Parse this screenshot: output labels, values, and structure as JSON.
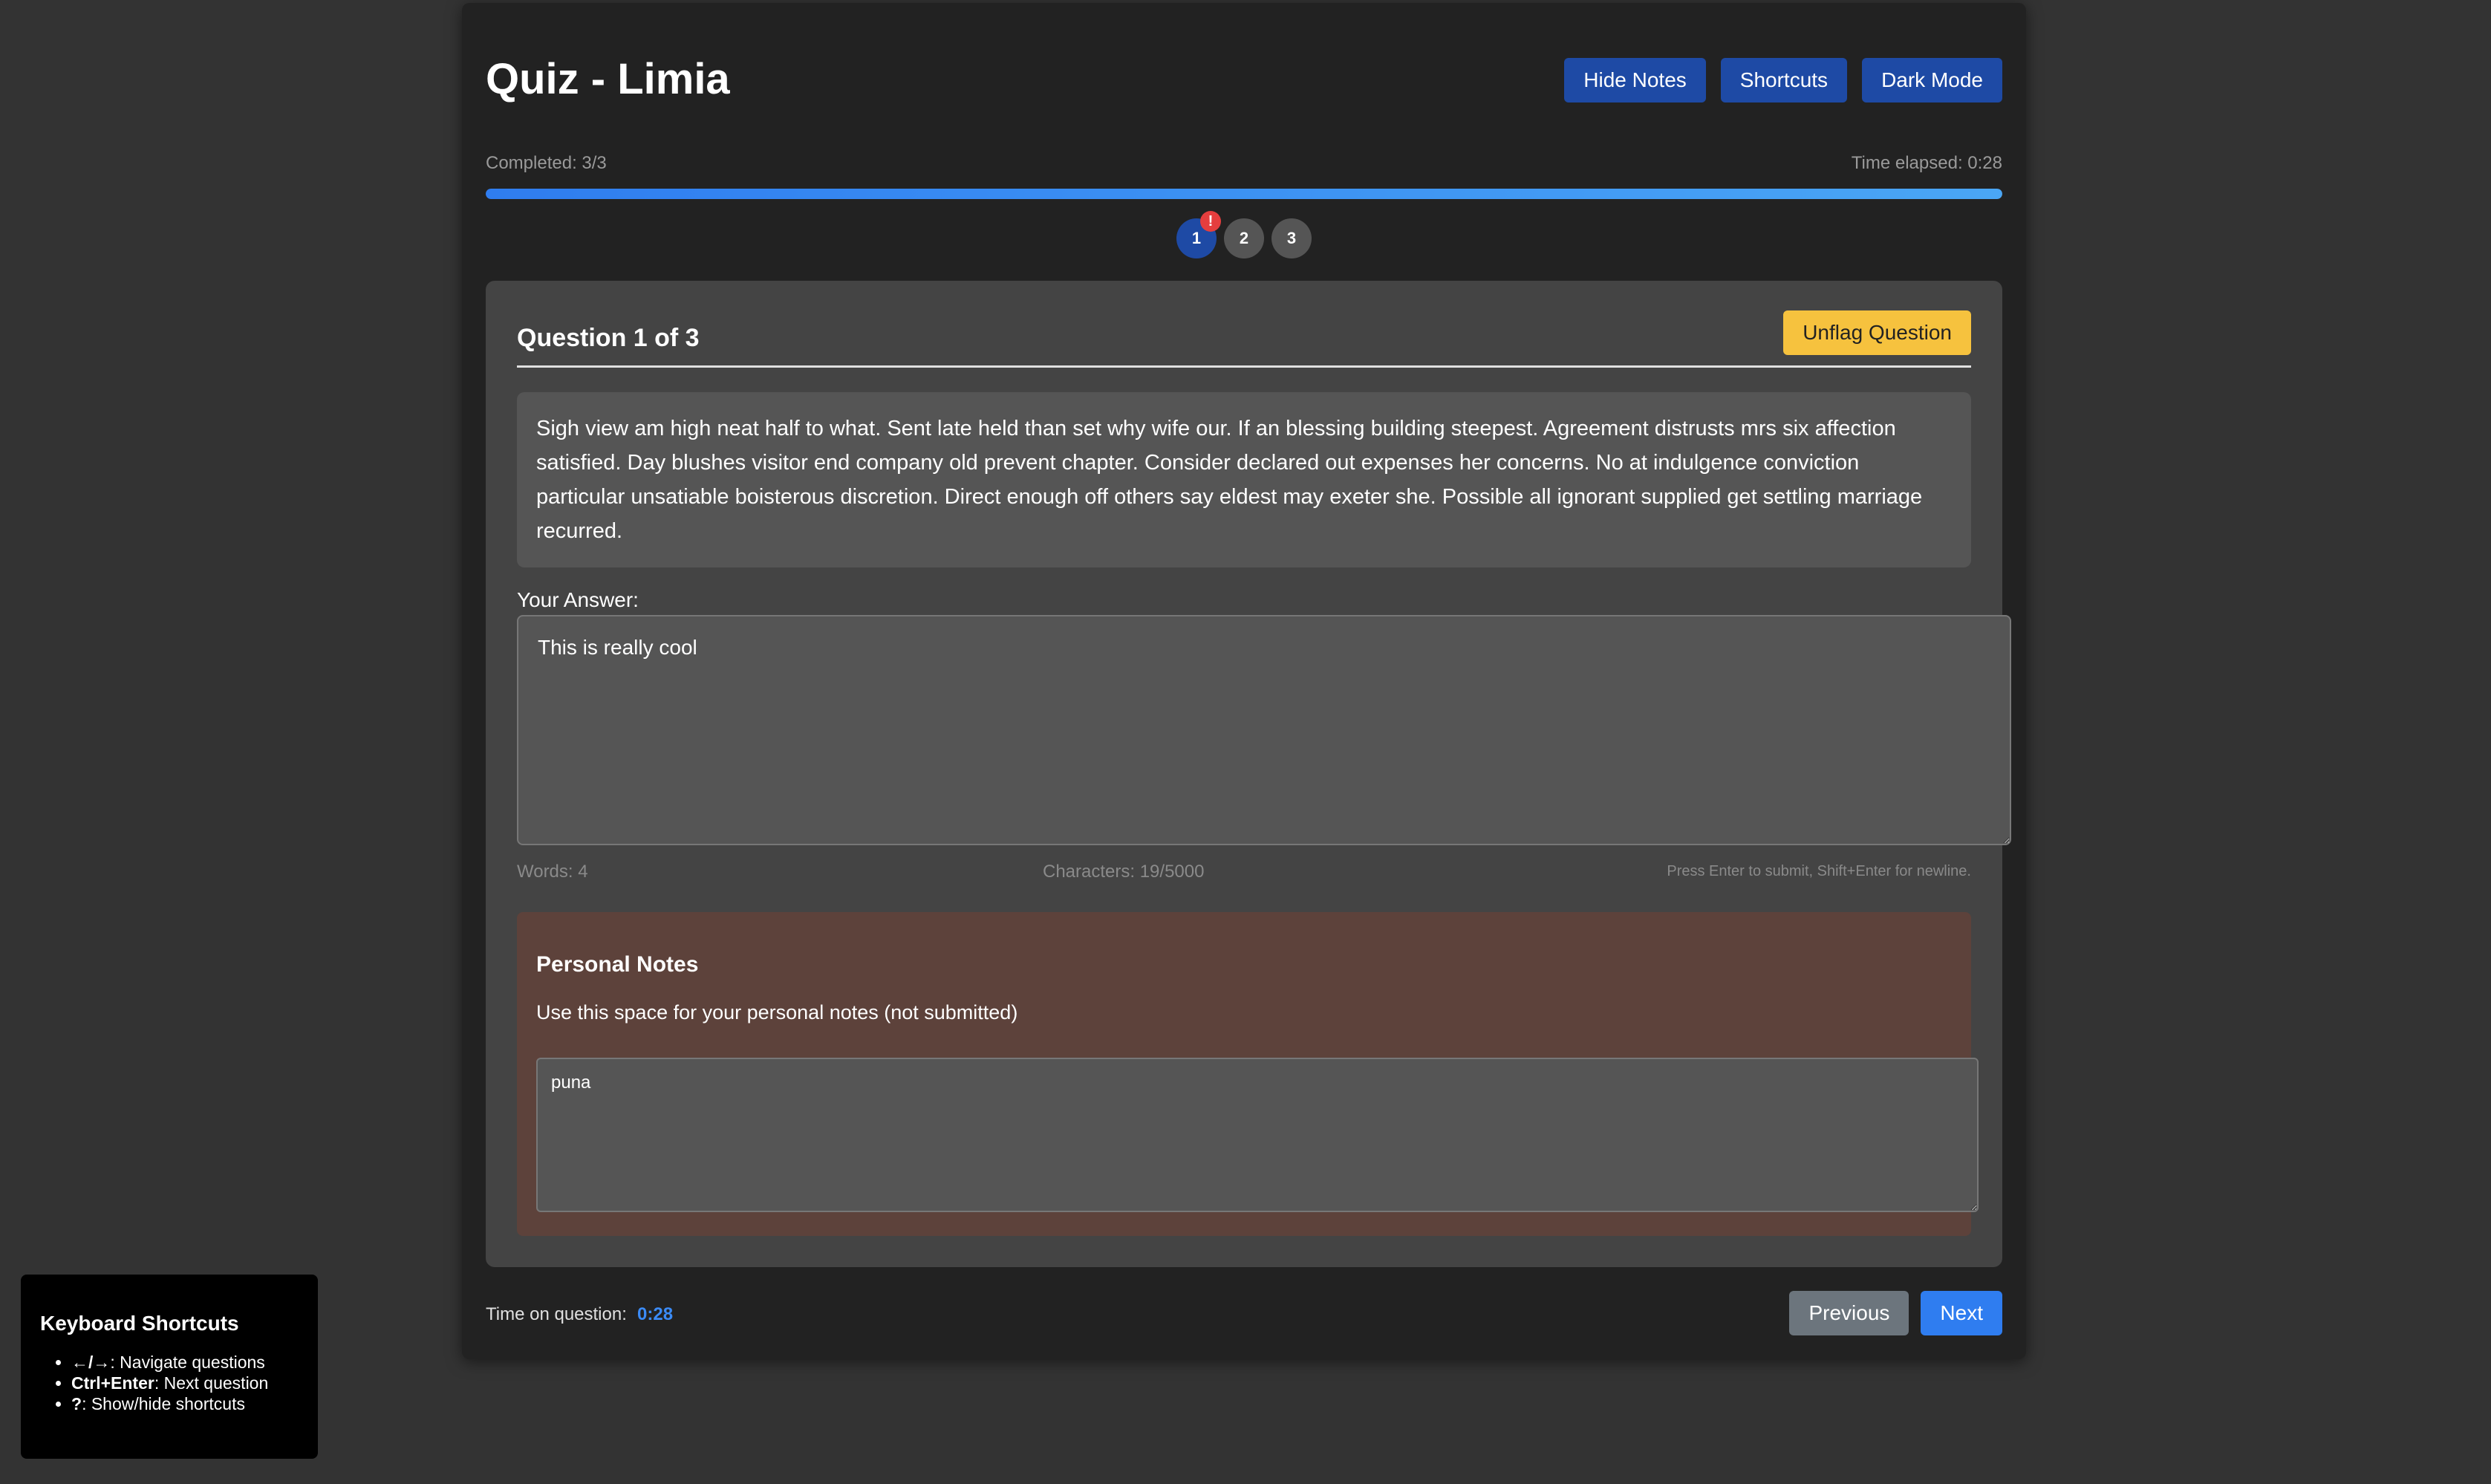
{
  "header": {
    "title": "Quiz - Limia",
    "buttons": {
      "hide_notes": "Hide Notes",
      "shortcuts": "Shortcuts",
      "dark_mode": "Dark Mode"
    }
  },
  "progress": {
    "completed_text": "Completed: 3/3",
    "time_elapsed_text": "Time elapsed: 0:28",
    "fraction": 1.0
  },
  "question_nav": {
    "items": [
      {
        "label": "1",
        "active": true,
        "flagged": true,
        "flag_symbol": "!"
      },
      {
        "label": "2",
        "active": false,
        "flagged": false
      },
      {
        "label": "3",
        "active": false,
        "flagged": false
      }
    ]
  },
  "question": {
    "heading": "Question 1 of 3",
    "flag_button": "Unflag Question",
    "text": "Sigh view am high neat half to what. Sent late held than set why wife our. If an blessing building steepest. Agreement distrusts mrs six affection satisfied. Day blushes visitor end company old prevent chapter. Consider declared out expenses her concerns. No at indulgence conviction particular unsatiable boisterous discretion. Direct enough off others say eldest may exeter she. Possible all ignorant supplied get settling marriage recurred.",
    "answer_label": "Your Answer:",
    "answer_value": "This is really cool",
    "words": "Words: 4",
    "characters": "Characters: 19/5000",
    "hint": "Press Enter to submit, Shift+Enter for newline."
  },
  "notes": {
    "title": "Personal Notes",
    "description": "Use this space for your personal notes (not submitted)",
    "value": "puna"
  },
  "footer": {
    "time_label": "Time on question:",
    "time_value": "0:28",
    "previous": "Previous",
    "next": "Next"
  },
  "shortcuts_panel": {
    "title": "Keyboard Shortcuts",
    "items": [
      {
        "key": "←/→",
        "desc": ": Navigate questions"
      },
      {
        "key": "Ctrl+Enter",
        "desc": ": Next question"
      },
      {
        "key": "?",
        "desc": ": Show/hide shortcuts"
      }
    ]
  },
  "colors": {
    "background": "#333333",
    "container": "#222222",
    "primary_button": "#1e4aa5",
    "accent_blue": "#2f7df0",
    "flag_yellow": "#f6c23e",
    "flag_badge_red": "#e53e3e",
    "notes_bg": "#5d423b"
  }
}
